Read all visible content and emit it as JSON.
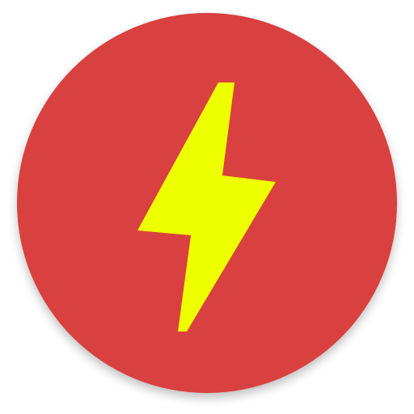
{
  "app_icon": {
    "icon_name": "lightning-bolt-icon",
    "colors": {
      "background": "#ffffff",
      "circle": "#d93f3f",
      "bolt": "#eeff00",
      "shadow": "#000000"
    }
  }
}
